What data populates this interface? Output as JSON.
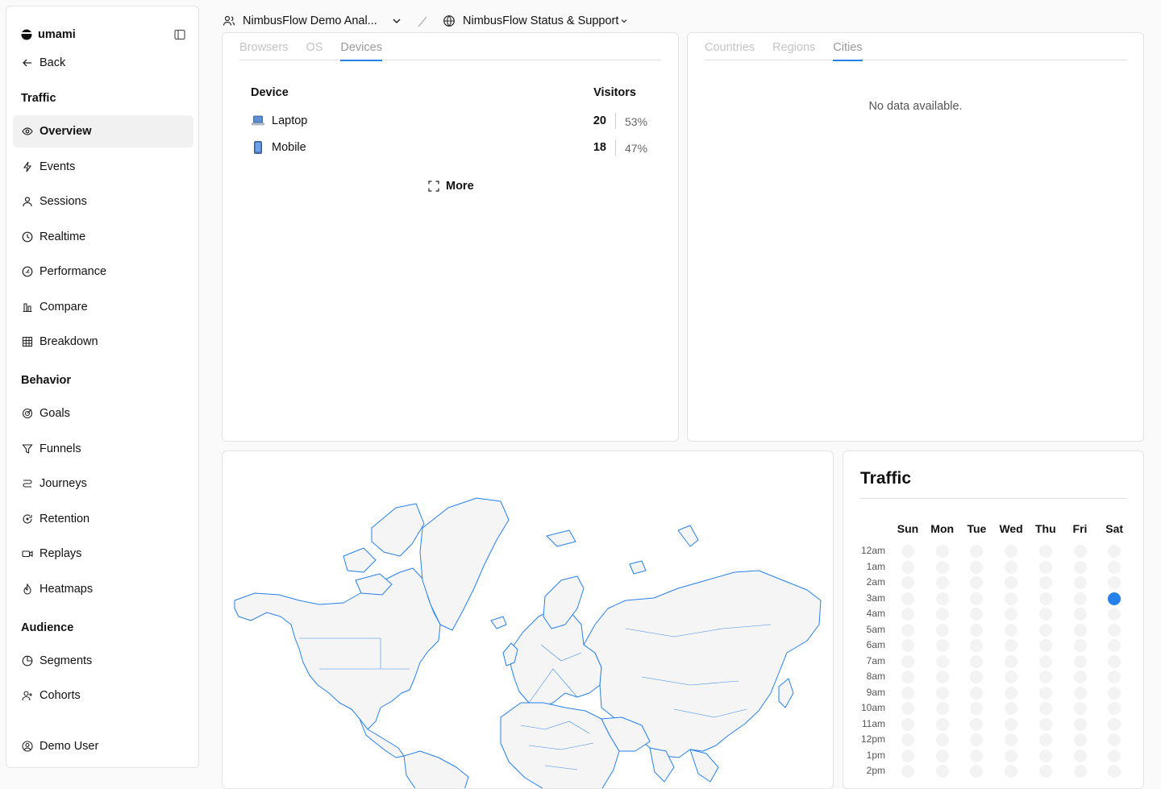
{
  "sidebar": {
    "brand": "umami",
    "back": "Back",
    "sections": {
      "traffic": "Traffic",
      "behavior": "Behavior",
      "audience": "Audience"
    },
    "items": [
      {
        "label": "Overview",
        "icon": "eye-icon",
        "active": true
      },
      {
        "label": "Events",
        "icon": "lightning-icon"
      },
      {
        "label": "Sessions",
        "icon": "user-icon"
      },
      {
        "label": "Realtime",
        "icon": "clock-icon"
      },
      {
        "label": "Performance",
        "icon": "gauge-icon"
      },
      {
        "label": "Compare",
        "icon": "compare-icon"
      },
      {
        "label": "Breakdown",
        "icon": "grid-icon"
      },
      {
        "label": "Goals",
        "icon": "target-icon"
      },
      {
        "label": "Funnels",
        "icon": "funnel-icon"
      },
      {
        "label": "Journeys",
        "icon": "route-icon"
      },
      {
        "label": "Retention",
        "icon": "retention-icon"
      },
      {
        "label": "Replays",
        "icon": "video-icon"
      },
      {
        "label": "Heatmaps",
        "icon": "flame-icon"
      },
      {
        "label": "Segments",
        "icon": "pie-icon"
      },
      {
        "label": "Cohorts",
        "icon": "user-plus-icon"
      }
    ],
    "user": "Demo User"
  },
  "header": {
    "team": "NimbusFlow Demo Anal...",
    "website": "NimbusFlow Status & Support"
  },
  "devices_card": {
    "tabs": [
      "Browsers",
      "OS",
      "Devices"
    ],
    "active_tab": "Devices",
    "col_label": "Device",
    "col_value": "Visitors",
    "rows": [
      {
        "label": "Laptop",
        "value": "20",
        "pct": "53%",
        "icon": "laptop-icon"
      },
      {
        "label": "Mobile",
        "value": "18",
        "pct": "47%",
        "icon": "mobile-icon"
      }
    ],
    "more": "More"
  },
  "location_card": {
    "tabs": [
      "Countries",
      "Regions",
      "Cities"
    ],
    "active_tab": "Cities",
    "empty": "No data available."
  },
  "traffic_card": {
    "title": "Traffic",
    "days": [
      "Sun",
      "Mon",
      "Tue",
      "Wed",
      "Thu",
      "Fri",
      "Sat"
    ],
    "hours": [
      "12am",
      "1am",
      "2am",
      "3am",
      "4am",
      "5am",
      "6am",
      "7am",
      "8am",
      "9am",
      "10am",
      "11am",
      "12pm",
      "1pm",
      "2pm"
    ],
    "highlight": {
      "day": "Sat",
      "hour": "3am"
    },
    "colors": {
      "accent": "#2680eb",
      "empty": "#f3f3f3"
    }
  },
  "map": {
    "stroke": "#2680eb",
    "fill": "#f5f5f5"
  }
}
